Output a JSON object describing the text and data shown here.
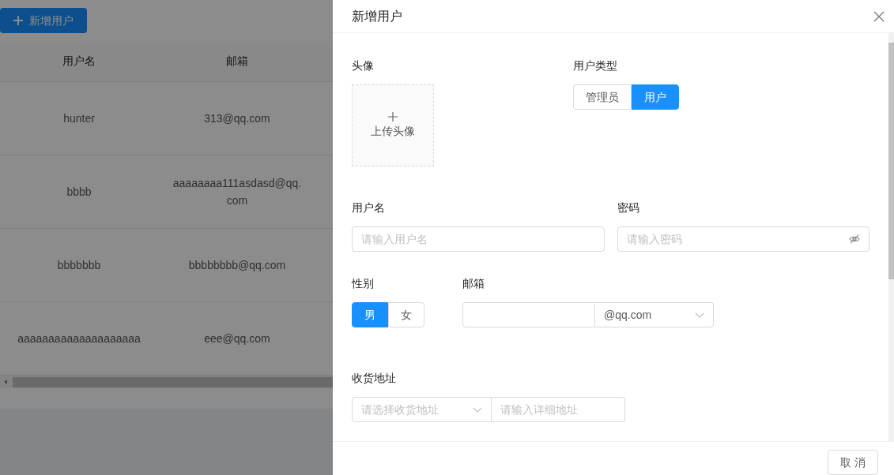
{
  "page": {
    "add_button": "新增用户",
    "table": {
      "columns": [
        "用户名",
        "邮箱"
      ],
      "rows": [
        [
          "hunter",
          "313@qq.com"
        ],
        [
          "bbbb",
          "aaaaaaaa111asdasd@qq.com"
        ],
        [
          "bbbbbbb",
          "bbbbbbbb@qq.com"
        ],
        [
          "aaaaaaaaaaaaaaaaaaaa",
          "eee@qq.com"
        ]
      ]
    }
  },
  "drawer": {
    "title": "新增用户",
    "avatar": {
      "label": "头像",
      "upload_text": "上传头像"
    },
    "user_type": {
      "label": "用户类型",
      "options": [
        {
          "label": "管理员",
          "selected": false
        },
        {
          "label": "用户",
          "selected": true
        }
      ]
    },
    "username": {
      "label": "用户名",
      "placeholder": "请输入用户名"
    },
    "password": {
      "label": "密码",
      "placeholder": "请输入密码"
    },
    "gender": {
      "label": "性别",
      "options": [
        {
          "label": "男",
          "selected": true
        },
        {
          "label": "女",
          "selected": false
        }
      ]
    },
    "email": {
      "label": "邮箱",
      "domain": "@qq.com"
    },
    "address": {
      "label": "收货地址",
      "region_placeholder": "请选择收货地址",
      "detail_placeholder": "请输入详细地址"
    },
    "footer_buttons": [
      "取 消"
    ]
  }
}
